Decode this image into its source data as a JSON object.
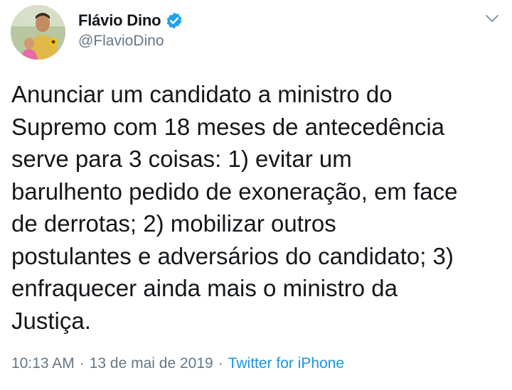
{
  "tweet": {
    "author": {
      "name": "Flávio Dino",
      "handle": "@FlavioDino",
      "verified": true,
      "avatar_icon": "profile-photo"
    },
    "menu_icon": "chevron-down-icon",
    "text": "Anunciar um candidato a ministro do\nSupremo com 18 meses de antecedência\nserve para 3 coisas: 1) evitar um\nbarulhento pedido de exoneração, em face\nde derrotas; 2) mobilizar outros\npostulantes e adversários do candidato; 3)\nenfraquecer ainda mais o ministro da\nJustiça.",
    "time": "10:13 AM",
    "date": "13 de mai de 2019",
    "separator": "·",
    "source": "Twitter for iPhone"
  },
  "colors": {
    "text": "#14171a",
    "secondary": "#657786",
    "link": "#1b95e0",
    "verified": "#1da1f2"
  }
}
